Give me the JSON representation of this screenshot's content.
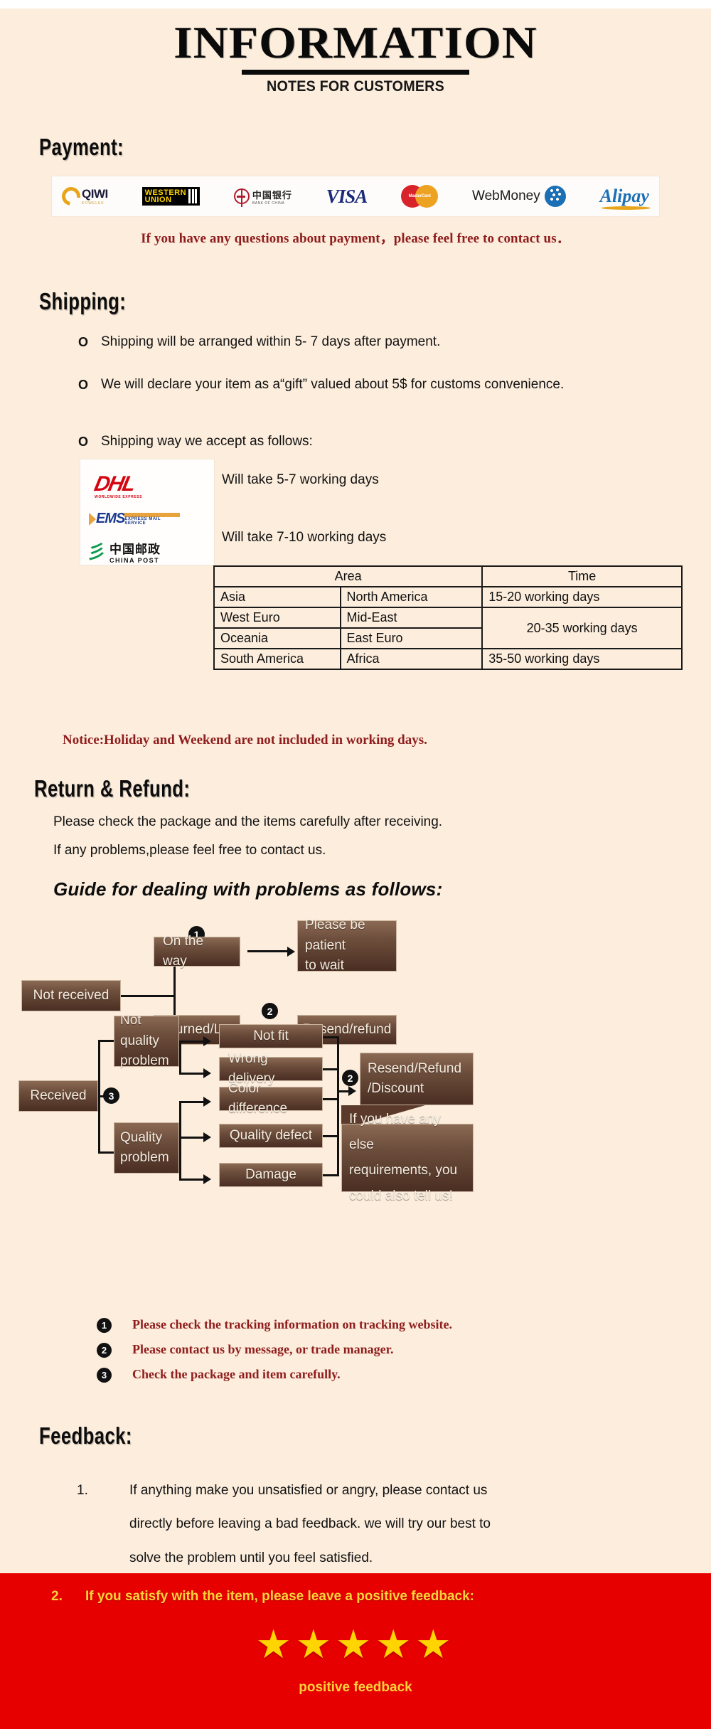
{
  "header": {
    "title": "INFORMATION",
    "subtitle": "NOTES FOR CUSTOMERS"
  },
  "payment": {
    "heading": "Payment:",
    "methods": [
      {
        "name": "qiwi",
        "label": "QIWI",
        "sub": "KOWELEK"
      },
      {
        "name": "western-union",
        "line1": "WESTERN",
        "line2": "UNION"
      },
      {
        "name": "bank-of-china",
        "cn": "中国银行",
        "en": "BANK OF CHINA"
      },
      {
        "name": "visa",
        "label": "VISA"
      },
      {
        "name": "mastercard",
        "label": "MasterCard"
      },
      {
        "name": "webmoney",
        "label": "WebMoney"
      },
      {
        "name": "alipay",
        "label": "Alipay"
      }
    ],
    "note": "If you have any questions about payment，please feel free to contact us．"
  },
  "shipping": {
    "heading": "Shipping:",
    "bullets": [
      "Shipping will be arranged within  5- 7  days after payment.",
      "We will declare your item as a“gift” valued about 5$ for customs convenience.",
      "Shipping way we accept as follows:"
    ],
    "carriers": [
      {
        "name": "dhl",
        "logo": "DHL",
        "logo_sub": "WORLDWIDE EXPRESS",
        "text": "Will take 5-7 working days"
      },
      {
        "name": "ems",
        "logo": "EMS",
        "logo_sub": "EXPRESS MAIL SERVICE",
        "text": "Will take 7-10 working days"
      },
      {
        "name": "china-post",
        "logo_cn": "中国邮政",
        "logo_en": "CHINA POST",
        "text": ""
      }
    ],
    "table": {
      "headers": [
        "Area",
        "Time"
      ],
      "rows": [
        {
          "area1": "Asia",
          "area2": "North America",
          "time": "15-20 working days"
        },
        {
          "area1": "West Euro",
          "area2": "Mid-East",
          "time": "20-35 working days"
        },
        {
          "area1": "Oceania",
          "area2": "East Euro",
          "time": ""
        },
        {
          "area1": "South America",
          "area2": "Africa",
          "time": "35-50 working days"
        }
      ]
    },
    "notice": "Notice:Holiday and Weekend are not included in working days."
  },
  "return_refund": {
    "heading": "Return & Refund:",
    "lines": [
      "Please check the package and the items carefully after receiving.",
      "If any problems,please feel free to contact us."
    ],
    "guide_title": "Guide for dealing with problems as follows:"
  },
  "flowchart": {
    "not_received": "Not received",
    "on_the_way": "On the way",
    "returned_lost": "Returned/Lost",
    "please_be_patient_1": "Please be patient",
    "please_be_patient_2": "to wait",
    "resend_refund": "Resend/refund",
    "received": "Received",
    "not_quality_1": "Not quality",
    "not_quality_2": "problem",
    "quality_1": "Quality",
    "quality_2": "problem",
    "not_fit": "Not fit",
    "wrong_delivery": "Wrong delivery",
    "color_difference": "Color difference",
    "quality_defect": "Quality defect",
    "damage": "Damage",
    "resend_refund_discount_1": "Resend/Refund",
    "resend_refund_discount_2": "/Discount",
    "callout_1": "If you have any else",
    "callout_2": "requirements, you",
    "callout_3": "could also tell us!",
    "marker_1": "❶",
    "marker_2": "❷",
    "marker_3": "❸"
  },
  "notes": [
    {
      "num": "1",
      "text": "Please check the tracking information on tracking website."
    },
    {
      "num": "2",
      "text": "Please contact us by message, or trade manager."
    },
    {
      "num": "3",
      "text": "Check the package and item carefully."
    }
  ],
  "feedback": {
    "heading": "Feedback:",
    "item1_num": "1.",
    "item1_l1": "If anything make you unsatisfied or angry, please contact us",
    "item1_l2": "directly before leaving a bad feedback. we will try our best to",
    "item1_l3": "solve the problem until  you feel satisfied.",
    "item2_num": "2.",
    "item2_text": "If you satisfy with the item, please leave a positive feedback:",
    "stars": "★★★★★",
    "star_count": 5,
    "caption": "positive feedback"
  },
  "colors": {
    "background": "#fceddc",
    "accent_red": "#8f1d1d",
    "banner_red": "#e60000",
    "star_yellow": "#ffd400",
    "node_brown": "#4a2e22"
  }
}
